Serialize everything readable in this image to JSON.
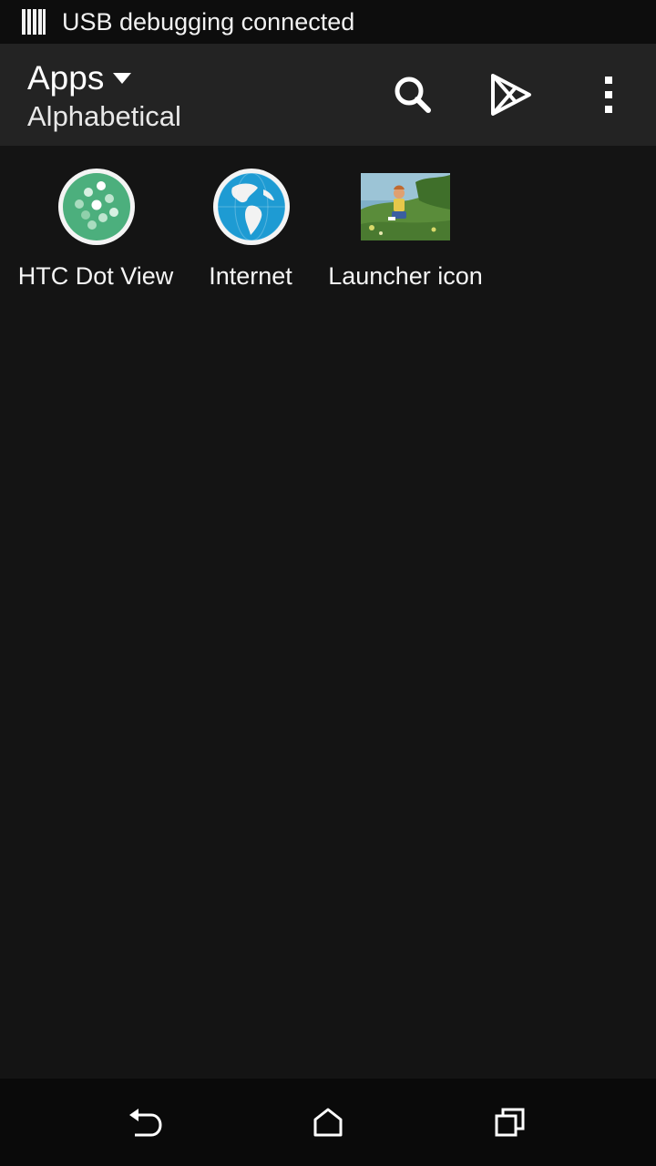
{
  "status_bar": {
    "notification_text": "USB debugging connected",
    "icon": "usb-debugging-icon"
  },
  "app_bar": {
    "title": "Apps",
    "subtitle": "Alphabetical",
    "actions": [
      {
        "icon": "search-icon"
      },
      {
        "icon": "play-store-icon"
      },
      {
        "icon": "overflow-menu-icon"
      }
    ]
  },
  "apps": [
    {
      "label": "HTC Dot View",
      "icon": "htc-dot-view-icon",
      "color": "#4caf7d"
    },
    {
      "label": "Internet",
      "icon": "globe-icon",
      "color": "#1e9bd3"
    },
    {
      "label": "Launcher icon",
      "icon": "picture-thumbnail-icon",
      "color": "#5a8c3a"
    }
  ],
  "nav_bar": {
    "buttons": [
      {
        "icon": "back-icon"
      },
      {
        "icon": "home-icon"
      },
      {
        "icon": "recent-apps-icon"
      }
    ]
  },
  "colors": {
    "background": "#141414",
    "app_bar": "#232323",
    "status_bar": "#0d0d0d",
    "nav_bar": "#0a0a0a"
  }
}
